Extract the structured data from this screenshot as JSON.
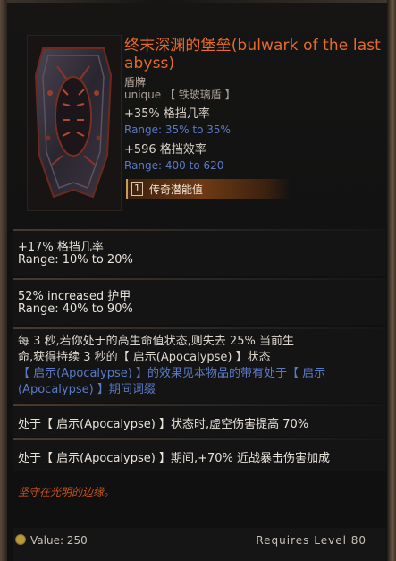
{
  "item": {
    "title": "终末深渊的堡垒(bulwark of the last abyss)",
    "subtype": "盾牌",
    "unique_label": "unique",
    "base": "【 铁玻璃盾 】",
    "implicits": [
      {
        "text": "+35% 格挡几率",
        "range": "Range: 35% to 35%"
      },
      {
        "text": "+596 格挡效率",
        "range": "Range: 400 to 620"
      }
    ],
    "legendary_potential": {
      "count": "1",
      "label": "传奇潜能值"
    }
  },
  "affixes": [
    {
      "text": "+17% 格挡几率",
      "range": "Range: 10% to 20%"
    },
    {
      "text": "52% increased 护甲",
      "range": "Range: 40% to 90%"
    }
  ],
  "unique_effect": {
    "line1": "每 3 秒,若你处于的高生命值状态,则失去 25% 当前生",
    "line2": "命,获得持续 3 秒的【 启示(Apocalypse) 】状态",
    "line3": "【 启示(Apocalypse) 】的效果见本物品的带有处于【 启示",
    "line4": "(Apocalypse) 】期间词缀"
  },
  "conditional_affixes": [
    "处于【 启示(Apocalypse) 】状态时,虚空伤害提高 70%",
    "处于【 启示(Apocalypse) 】期间,+70% 近战暴击伤害加成"
  ],
  "flavor_text": "坚守在光明的边缘。",
  "footer": {
    "value": "Value: 250",
    "requires": "Requires Level 80"
  },
  "colors": {
    "title": "#e66a2a",
    "range": "#5a7ac6",
    "flavor": "#c7531c",
    "legendary_bar": "#6f3b15"
  },
  "icons": [
    "shield-item-icon",
    "coin-icon"
  ]
}
